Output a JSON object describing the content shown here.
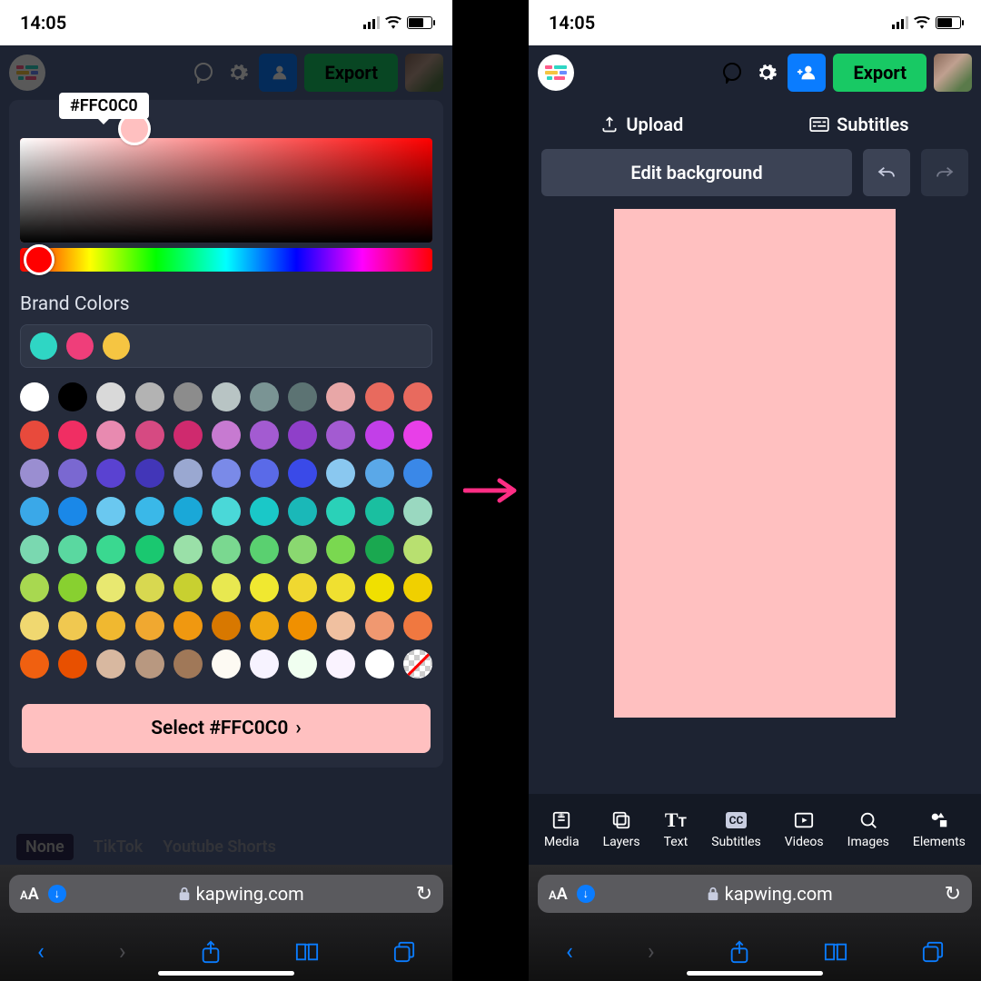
{
  "status": {
    "time": "14:05"
  },
  "header": {
    "export_label": "Export"
  },
  "picker": {
    "current_hex": "#FFC0C0",
    "hue_base": "#ff0000",
    "brand_title": "Brand Colors",
    "brand_colors": [
      "#2fd6c4",
      "#ef3e7a",
      "#f5c542"
    ],
    "select_label": "Select #FFC0C0",
    "grid_colors": [
      "#ffffff",
      "#000000",
      "#d9d9d9",
      "#b3b3b3",
      "#8c8c8c",
      "#b8c4c4",
      "#7a9494",
      "#5c7373",
      "#e8a7a7",
      "#e86a5e",
      "#e86a5e",
      "#e84a3c",
      "#f02e63",
      "#e88ab0",
      "#d64a82",
      "#cf2a6e",
      "#c77ad1",
      "#a35bd1",
      "#8f3fc9",
      "#a35bd1",
      "#c23fe8",
      "#e83fe8",
      "#9a8ed1",
      "#7a68d1",
      "#5a42d1",
      "#4236b8",
      "#9aa8d1",
      "#7a8ae8",
      "#5a6ae8",
      "#3a4ae8",
      "#8ac8f0",
      "#5aa8e8",
      "#3a88e8",
      "#3aa8e8",
      "#1a88e8",
      "#6ac8f0",
      "#3ab8e8",
      "#1aa8d8",
      "#4ad8d8",
      "#1ac8c8",
      "#1ab8b8",
      "#2ad1b8",
      "#1abfa0",
      "#9ad8c0",
      "#7ad8b0",
      "#5ad8a0",
      "#3ad890",
      "#1ac870",
      "#9ae0a8",
      "#7ad890",
      "#5ad070",
      "#8ad870",
      "#7ad850",
      "#1aa850",
      "#b8e070",
      "#a8d850",
      "#88d030",
      "#e8e870",
      "#d8d850",
      "#c8d030",
      "#e8e850",
      "#f0e830",
      "#f0d830",
      "#f0e030",
      "#f0e000",
      "#f0d000",
      "#f0d870",
      "#f0c850",
      "#f0b830",
      "#f0a830",
      "#f09810",
      "#d87800",
      "#f0a810",
      "#f09000",
      "#f0c0a0",
      "#f09870",
      "#f07840",
      "#f06010",
      "#e85000",
      "#d8b8a0",
      "#b89880",
      "#a07858",
      "#fdfaf3",
      "#f7f3ff",
      "#f0fff0",
      "#faf3ff",
      "#ffffff",
      "transparent"
    ],
    "behind_tabs": [
      "None",
      "TikTok",
      "Youtube Shorts"
    ],
    "behind_active_index": 0
  },
  "editor": {
    "upload_label": "Upload",
    "subtitles_label": "Subtitles",
    "edit_bg_label": "Edit background",
    "canvas_color": "#FFC0C0",
    "tools": [
      "Media",
      "Layers",
      "Text",
      "Subtitles",
      "Videos",
      "Images",
      "Elements"
    ]
  },
  "safari": {
    "domain": "kapwing.com"
  }
}
